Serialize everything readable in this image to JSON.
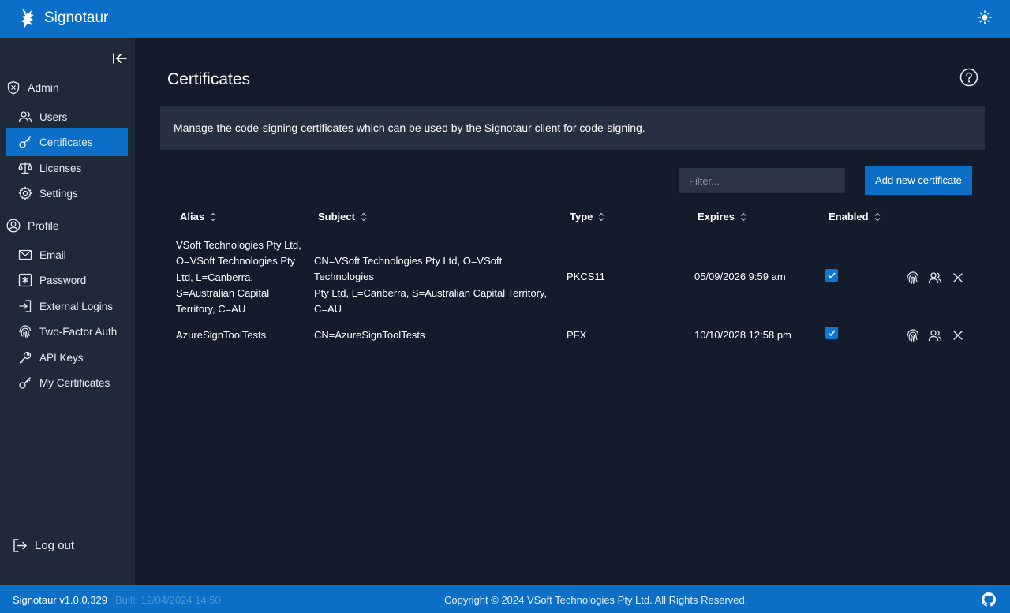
{
  "header": {
    "app_title": "Signotaur",
    "logo_icon": "signotaur-logo-icon",
    "theme_icon": "sun-icon"
  },
  "sidebar": {
    "sections": [
      {
        "label": "Admin",
        "icon": "shield-icon"
      },
      {
        "label": "Profile",
        "icon": "user-circle-icon"
      }
    ],
    "items": [
      {
        "label": "Users",
        "icon": "users-icon"
      },
      {
        "label": "Certificates",
        "icon": "key-icon",
        "active": true
      },
      {
        "label": "Licenses",
        "icon": "scale-icon"
      },
      {
        "label": "Settings",
        "icon": "gear-icon"
      },
      {
        "label": "Email",
        "icon": "envelope-icon"
      },
      {
        "label": "Password",
        "icon": "asterisk-icon"
      },
      {
        "label": "External Logins",
        "icon": "login-arrow-icon"
      },
      {
        "label": "Two-Factor Auth",
        "icon": "fingerprint-icon"
      },
      {
        "label": "API Keys",
        "icon": "key-icon"
      },
      {
        "label": "My Certificates",
        "icon": "key-icon"
      }
    ],
    "logout_label": "Log out"
  },
  "main": {
    "title": "Certificates",
    "description": "Manage the code-signing certificates which can be used by the Signotaur client for code-signing.",
    "filter_placeholder": "Filter...",
    "add_button_label": "Add new certificate",
    "columns": [
      "Alias",
      "Subject",
      "Type",
      "Expires",
      "Enabled"
    ],
    "rows": [
      {
        "alias_lines": [
          "VSoft Technologies Pty Ltd,",
          "O=VSoft Technologies Pty",
          "Ltd, L=Canberra,",
          "S=Australian Capital",
          "Territory, C=AU"
        ],
        "subject_lines": [
          "CN=VSoft Technologies Pty Ltd, O=VSoft Technologies",
          "Pty Ltd, L=Canberra, S=Australian Capital Territory,",
          "C=AU"
        ],
        "type": "PKCS11",
        "expires": "05/09/2026 9:59 am",
        "enabled": true
      },
      {
        "alias_lines": [
          "AzureSignToolTests"
        ],
        "subject_lines": [
          "CN=AzureSignToolTests"
        ],
        "type": "PFX",
        "expires": "10/10/2028 12:58 pm",
        "enabled": true
      }
    ]
  },
  "footer": {
    "version": "Signotaur v1.0.0.329",
    "built": "Built: 12/04/2024 14:50",
    "copyright": "Copyright © 2024 VSoft Technologies Pty Ltd. All Rights Reserved.",
    "github_icon": "github-icon"
  },
  "colors": {
    "accent": "#0b6fc7",
    "background": "#141c2b",
    "sidebar": "#1f2938",
    "panel": "#263040"
  }
}
